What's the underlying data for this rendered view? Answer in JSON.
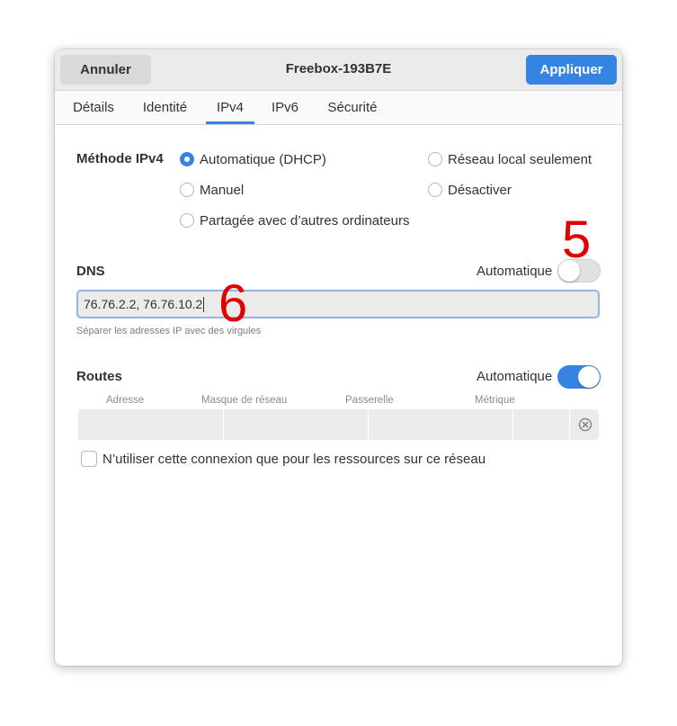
{
  "header": {
    "cancel_label": "Annuler",
    "title": "Freebox-193B7E",
    "apply_label": "Appliquer"
  },
  "tabs": [
    {
      "label": "Détails",
      "active": false
    },
    {
      "label": "Identité",
      "active": false
    },
    {
      "label": "IPv4",
      "active": true
    },
    {
      "label": "IPv6",
      "active": false
    },
    {
      "label": "Sécurité",
      "active": false
    }
  ],
  "method": {
    "label": "Méthode IPv4",
    "options": [
      {
        "label": "Automatique (DHCP)",
        "checked": true
      },
      {
        "label": "Réseau local seulement",
        "checked": false
      },
      {
        "label": "Manuel",
        "checked": false
      },
      {
        "label": "Désactiver",
        "checked": false
      },
      {
        "label": "Partagée avec d’autres ordinateurs",
        "checked": false
      }
    ]
  },
  "dns": {
    "label": "DNS",
    "auto_label": "Automatique",
    "auto_enabled": false,
    "value": "76.76.2.2, 76.76.10.2",
    "hint": "Séparer les adresses IP avec des virgules"
  },
  "routes": {
    "label": "Routes",
    "auto_label": "Automatique",
    "auto_enabled": true,
    "columns": [
      "Adresse",
      "Masque de réseau",
      "Passerelle",
      "Métrique"
    ]
  },
  "restrict_checkbox": {
    "label": "N’utiliser cette connexion que pour les ressources sur ce réseau",
    "checked": false
  },
  "annotations": [
    "5",
    "6"
  ],
  "colors": {
    "accent": "#3584e4",
    "annotation": "#e00000"
  }
}
